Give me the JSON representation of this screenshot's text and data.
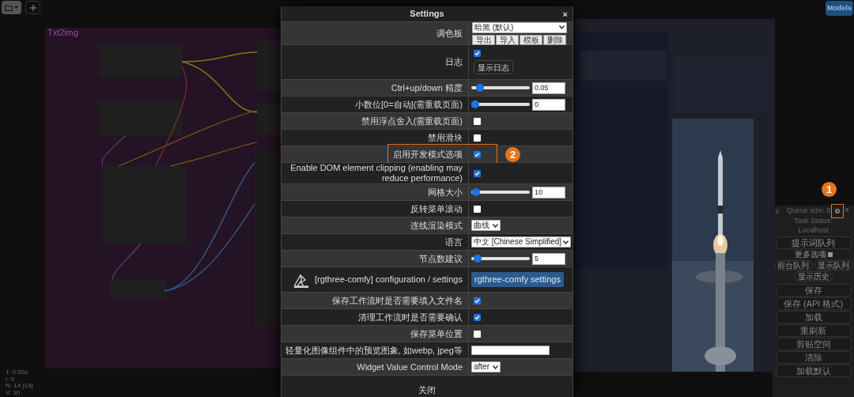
{
  "canvas": {
    "group_title": "Txt2img",
    "models_button": "Models",
    "stats": [
      "T: 0.00s",
      "I: 0",
      "N: 14 [14]",
      "V: 30"
    ]
  },
  "settings": {
    "title": "Settings",
    "close": "×",
    "footer": "关闭",
    "rows": [
      {
        "kind": "palette",
        "label": "调色板",
        "value": "暗黑 (默认)",
        "buttons": [
          "导出",
          "导入",
          "模板",
          "删除"
        ]
      },
      {
        "kind": "log",
        "label": "日志",
        "checked": true,
        "button": "显示日志"
      },
      {
        "kind": "slider",
        "label": "Ctrl+up/down 精度",
        "level": 0.1,
        "value": "0.05"
      },
      {
        "kind": "slider",
        "label": "小数位[0=自动](需重载页面)",
        "level": 0,
        "value": "0"
      },
      {
        "kind": "checkbox",
        "label": "禁用浮点舍入(需重载页面)",
        "checked": false
      },
      {
        "kind": "checkbox",
        "label": "禁用滑块",
        "checked": false
      },
      {
        "kind": "checkbox",
        "label": "启用开发模式选项",
        "checked": true,
        "badge": "2"
      },
      {
        "kind": "checkbox",
        "label": "Enable DOM element clipping (enabling may reduce performance)",
        "checked": true
      },
      {
        "kind": "slider",
        "label": "网格大小",
        "level": 0.02,
        "value": "10"
      },
      {
        "kind": "checkbox",
        "label": "反转菜单滚动",
        "checked": false
      },
      {
        "kind": "select",
        "label": "连线渲染模式",
        "value": "曲线"
      },
      {
        "kind": "select",
        "label": "语言",
        "value": "中文 [Chinese Simplified]"
      },
      {
        "kind": "slider",
        "label": "节点数建议",
        "level": 0.05,
        "value": "5"
      },
      {
        "kind": "button",
        "label": "[rgthree-comfy] configuration / settings",
        "button": "rgthree-comfy settings"
      },
      {
        "kind": "checkbox",
        "label": "保存工作流时是否需要填入文件名",
        "checked": true
      },
      {
        "kind": "checkbox",
        "label": "清理工作流时是否需要确认",
        "checked": true
      },
      {
        "kind": "checkbox",
        "label": "保存菜单位置",
        "checked": false
      },
      {
        "kind": "text",
        "label": "轻量化图像组件中的预览图象, 如webp, jpeg等"
      },
      {
        "kind": "select",
        "label": "Widget Value Control Mode",
        "value": "after"
      }
    ]
  },
  "queue_panel": {
    "queue_size": "Queue size: 0",
    "badge": "1",
    "close": "×",
    "task_status": "Task Status:",
    "host": "Localhost",
    "queue_button": "提示词队列",
    "more_options": "更多选项",
    "more_checked": false,
    "small_buttons": [
      "前台队列",
      "显示队列",
      "显示历史"
    ],
    "buttons": [
      "保存",
      "保存 (API 格式)",
      "加载",
      "重刷新",
      "剪贴空间",
      "清除",
      "加载默认"
    ]
  }
}
